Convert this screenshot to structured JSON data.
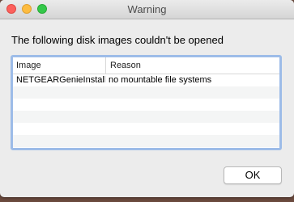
{
  "window": {
    "title": "Warning"
  },
  "message": "The following disk images couldn't be opened",
  "table": {
    "columns": [
      "Image",
      "Reason"
    ],
    "rows": [
      {
        "image": "NETGEARGenieInstalle",
        "reason": "no mountable file systems"
      }
    ]
  },
  "buttons": {
    "ok_label": "OK"
  },
  "colors": {
    "close": "#fc605c",
    "minimize": "#fdbc40",
    "maximize": "#34c84a",
    "focus_ring": "#9dbce8"
  }
}
